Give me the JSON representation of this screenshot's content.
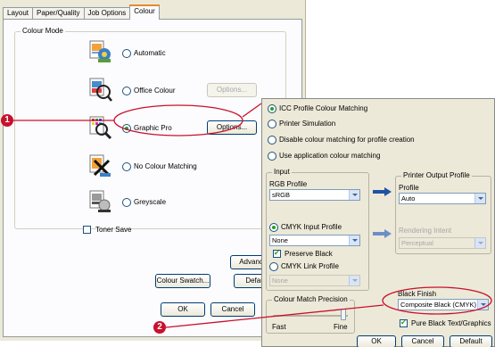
{
  "tabs": [
    {
      "label": "Layout"
    },
    {
      "label": "Paper/Quality"
    },
    {
      "label": "Job Options"
    },
    {
      "label": "Colour"
    }
  ],
  "colour_mode": {
    "group_label": "Colour Mode",
    "options": [
      {
        "label": "Automatic",
        "checked": false
      },
      {
        "label": "Office Colour",
        "checked": false,
        "button": "Options..."
      },
      {
        "label": "Graphic Pro",
        "checked": true,
        "button": "Options..."
      },
      {
        "label": "No Colour Matching",
        "checked": false
      },
      {
        "label": "Greyscale",
        "checked": false
      }
    ]
  },
  "toner_save": {
    "label": "Toner Save",
    "checked": false
  },
  "buttons": {
    "advanced": "Advanced",
    "colour_swatch": "Colour Swatch...",
    "default": "Default",
    "ok": "OK",
    "cancel": "Cancel"
  },
  "dialog": {
    "options": [
      {
        "label": "ICC Profile Colour Matching",
        "checked": true
      },
      {
        "label": "Printer Simulation",
        "checked": false
      },
      {
        "label": "Disable colour matching for profile creation",
        "checked": false
      },
      {
        "label": "Use application colour matching",
        "checked": false
      }
    ],
    "input": {
      "group_label": "Input",
      "rgb_profile_label": "RGB Profile",
      "rgb_profile_value": "sRGB",
      "cmyk_input_label": "CMYK Input Profile",
      "cmyk_input_value": "None",
      "preserve_black_label": "Preserve Black",
      "cmyk_link_label": "CMYK Link Profile",
      "cmyk_link_value": "None"
    },
    "printer_output": {
      "group_label": "Printer Output Profile",
      "profile_label": "Profile",
      "profile_value": "Auto",
      "rendering_intent_label": "Rendering Intent",
      "rendering_intent_value": "Perceptual"
    },
    "colour_match_precision": {
      "group_label": "Colour Match Precision",
      "left_label": "Fast",
      "right_label": "Fine"
    },
    "black_finish": {
      "label": "Black Finish",
      "value": "Composite Black (CMYK)",
      "pure_black_label": "Pure Black Text/Graphics"
    },
    "buttons": {
      "ok": "OK",
      "cancel": "Cancel",
      "default": "Default"
    }
  },
  "callouts": [
    "1",
    "2"
  ],
  "colors": {
    "callout_red": "#c8102e",
    "tab_highlight": "#e68b2c",
    "arrow_blue": "#2153a5"
  }
}
